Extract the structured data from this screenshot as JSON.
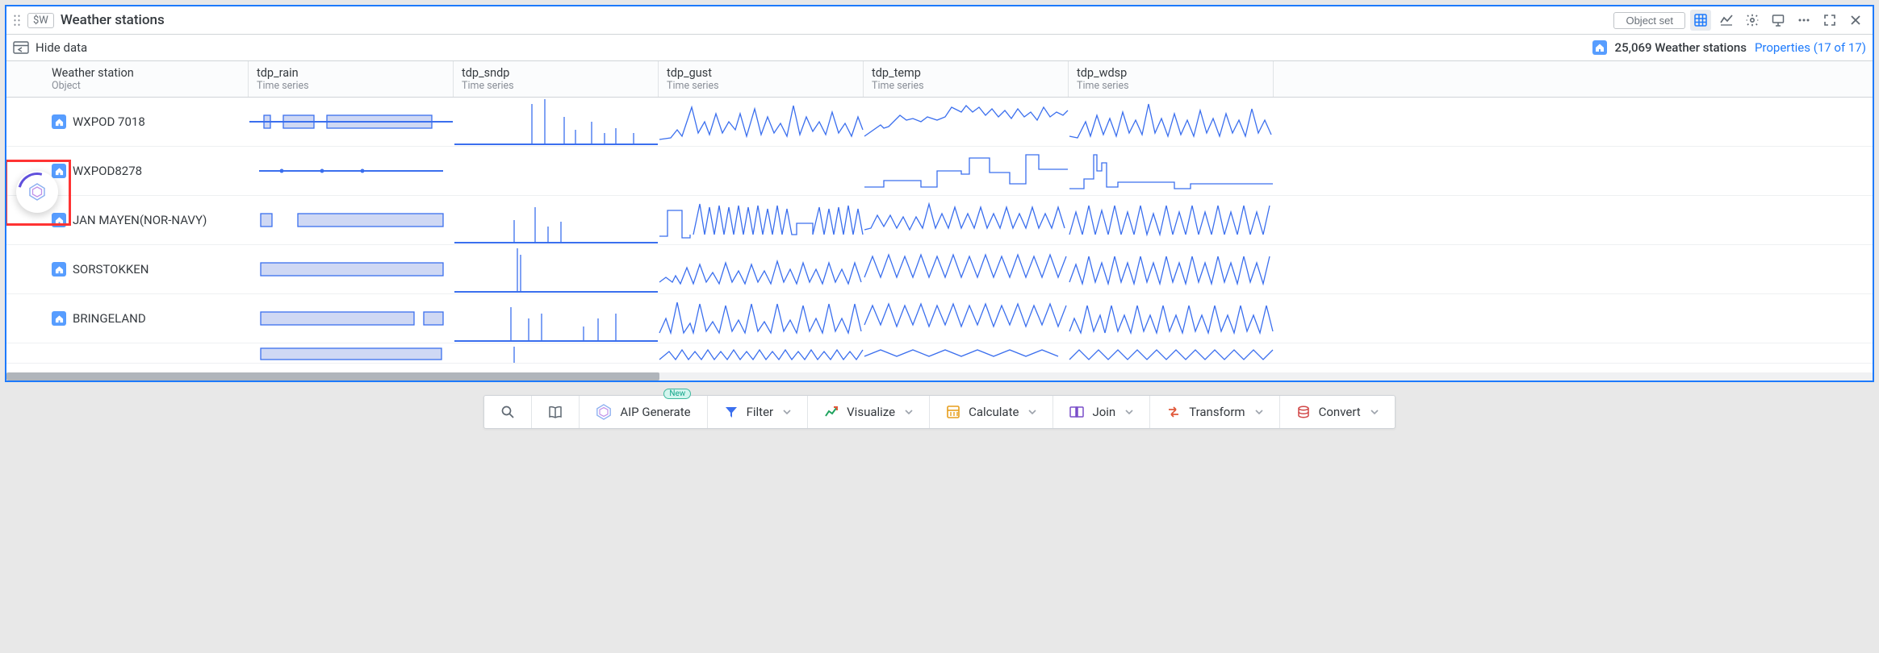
{
  "header": {
    "var_label": "$W",
    "title": "Weather stations",
    "object_set_btn": "Object set",
    "hide_data": "Hide data",
    "count": "25,069 Weather stations",
    "properties_link": "Properties (17 of 17)"
  },
  "columns": [
    {
      "title": "Weather station",
      "subtitle": "Object"
    },
    {
      "title": "tdp_rain",
      "subtitle": "Time series"
    },
    {
      "title": "tdp_sndp",
      "subtitle": "Time series"
    },
    {
      "title": "tdp_gust",
      "subtitle": "Time series"
    },
    {
      "title": "tdp_temp",
      "subtitle": "Time series"
    },
    {
      "title": "tdp_wdsp",
      "subtitle": "Time series"
    }
  ],
  "rows": [
    {
      "name": "WXPOD 7018"
    },
    {
      "name": "WXPOD8278"
    },
    {
      "name": "JAN MAYEN(NOR-NAVY)"
    },
    {
      "name": "SORSTOKKEN"
    },
    {
      "name": "BRINGELAND"
    }
  ],
  "toolbar": {
    "aip_generate": "AIP Generate",
    "new_label": "New",
    "filter": "Filter",
    "visualize": "Visualize",
    "calculate": "Calculate",
    "join": "Join",
    "transform": "Transform",
    "convert": "Convert"
  }
}
